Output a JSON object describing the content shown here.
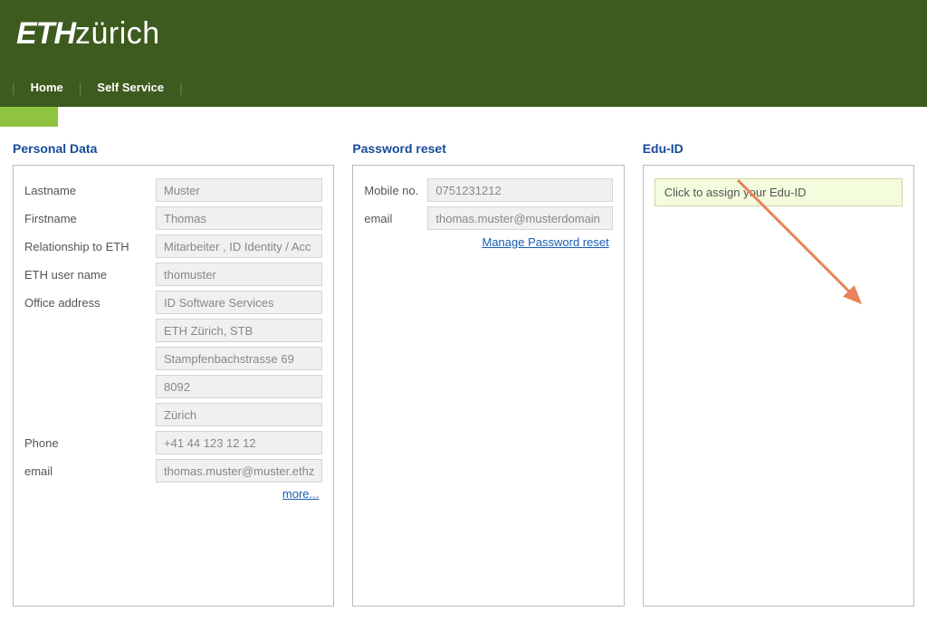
{
  "header": {
    "logo_bold": "ETH",
    "logo_light": "zürich"
  },
  "nav": {
    "home": "Home",
    "self_service": "Self Service"
  },
  "columns": {
    "personal": {
      "title": "Personal Data",
      "lastname_label": "Lastname",
      "lastname_value": "Muster",
      "firstname_label": "Firstname",
      "firstname_value": "Thomas",
      "relationship_label": "Relationship to ETH",
      "relationship_value": "Mitarbeiter , ID Identity / Acc",
      "username_label": "ETH user name",
      "username_value": "thomuster",
      "office_label": "Office address",
      "office_1": "ID Software Services",
      "office_2": "ETH Zürich, STB",
      "office_3": "Stampfenbachstrasse 69",
      "office_4": "8092",
      "office_5": "Zürich",
      "phone_label": "Phone",
      "phone_value": "+41 44 123 12 12",
      "email_label": "email",
      "email_value": "thomas.muster@muster.ethz",
      "more_link": "more..."
    },
    "password": {
      "title": "Password reset",
      "mobile_label": "Mobile no.",
      "mobile_value": "0751231212",
      "email_label": "email",
      "email_value": "thomas.muster@musterdomain",
      "manage_link": "Manage Password reset"
    },
    "eduid": {
      "title": "Edu-ID",
      "button": "Click to assign your Edu-ID"
    }
  }
}
